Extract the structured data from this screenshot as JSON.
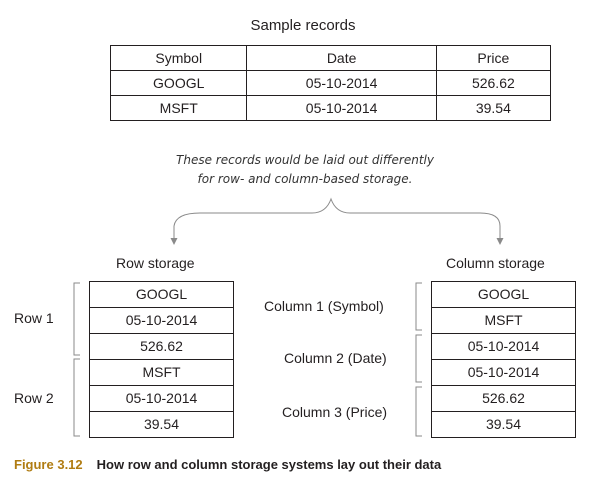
{
  "title": "Sample records",
  "table": {
    "headers": [
      "Symbol",
      "Date",
      "Price"
    ],
    "rows": [
      [
        "GOOGL",
        "05-10-2014",
        "526.62"
      ],
      [
        "MSFT",
        "05-10-2014",
        "39.54"
      ]
    ]
  },
  "note": {
    "line1": "These records would be laid out differently",
    "line2": "for row- and column-based storage."
  },
  "row_storage": {
    "heading": "Row storage",
    "cells": [
      "GOOGL",
      "05-10-2014",
      "526.62",
      "MSFT",
      "05-10-2014",
      "39.54"
    ],
    "groups": [
      "Row 1",
      "Row 2"
    ]
  },
  "column_storage": {
    "heading": "Column storage",
    "cells": [
      "GOOGL",
      "MSFT",
      "05-10-2014",
      "05-10-2014",
      "526.62",
      "39.54"
    ],
    "groups": [
      "Column 1 (Symbol)",
      "Column 2 (Date)",
      "Column 3 (Price)"
    ]
  },
  "caption": {
    "figure": "Figure 3.12",
    "text": "How row and column storage systems lay out their data"
  },
  "colors": {
    "caption_accent": "#b07c12",
    "line": "#8a8a8a"
  }
}
